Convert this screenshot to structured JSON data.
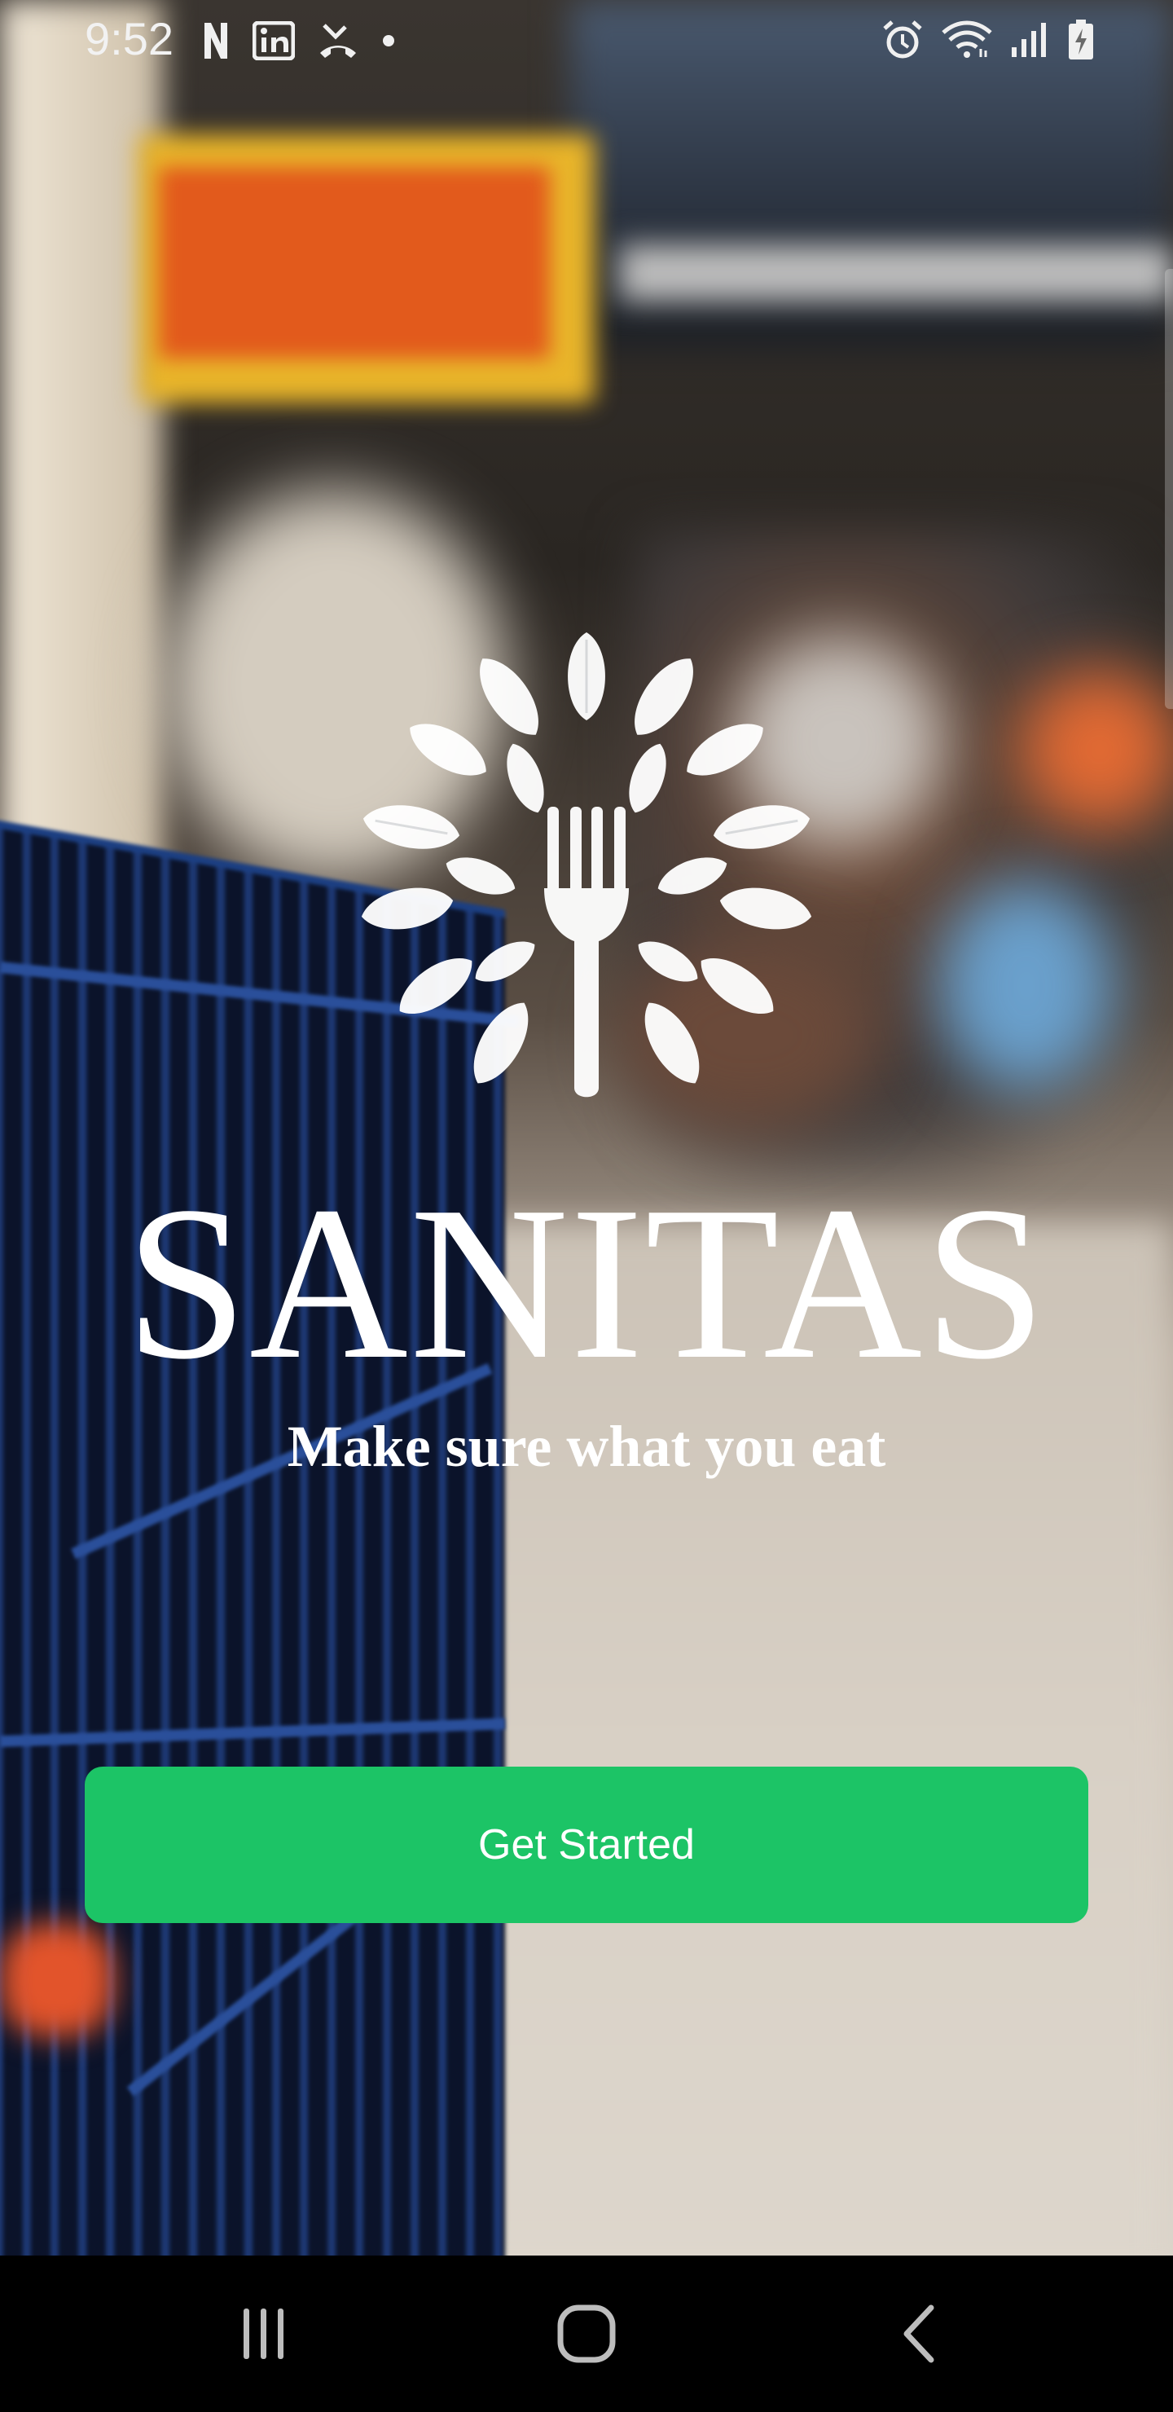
{
  "status_bar": {
    "time": "9:52",
    "left_icons": [
      "netflix-n-icon",
      "linkedin-icon",
      "missed-call-icon",
      "dot-icon"
    ],
    "right_icons": [
      "alarm-icon",
      "wifi-icon",
      "signal-icon",
      "battery-charging-icon"
    ]
  },
  "brand": {
    "title": "SANITAS",
    "tagline": "Make sure what you eat"
  },
  "actions": {
    "get_started_label": "Get Started"
  },
  "colors": {
    "primary_button": "#1cc466",
    "text": "#ffffff",
    "nav_background": "#000000"
  },
  "nav_bar": {
    "buttons": [
      "recent-apps-icon",
      "home-icon",
      "back-icon"
    ]
  }
}
